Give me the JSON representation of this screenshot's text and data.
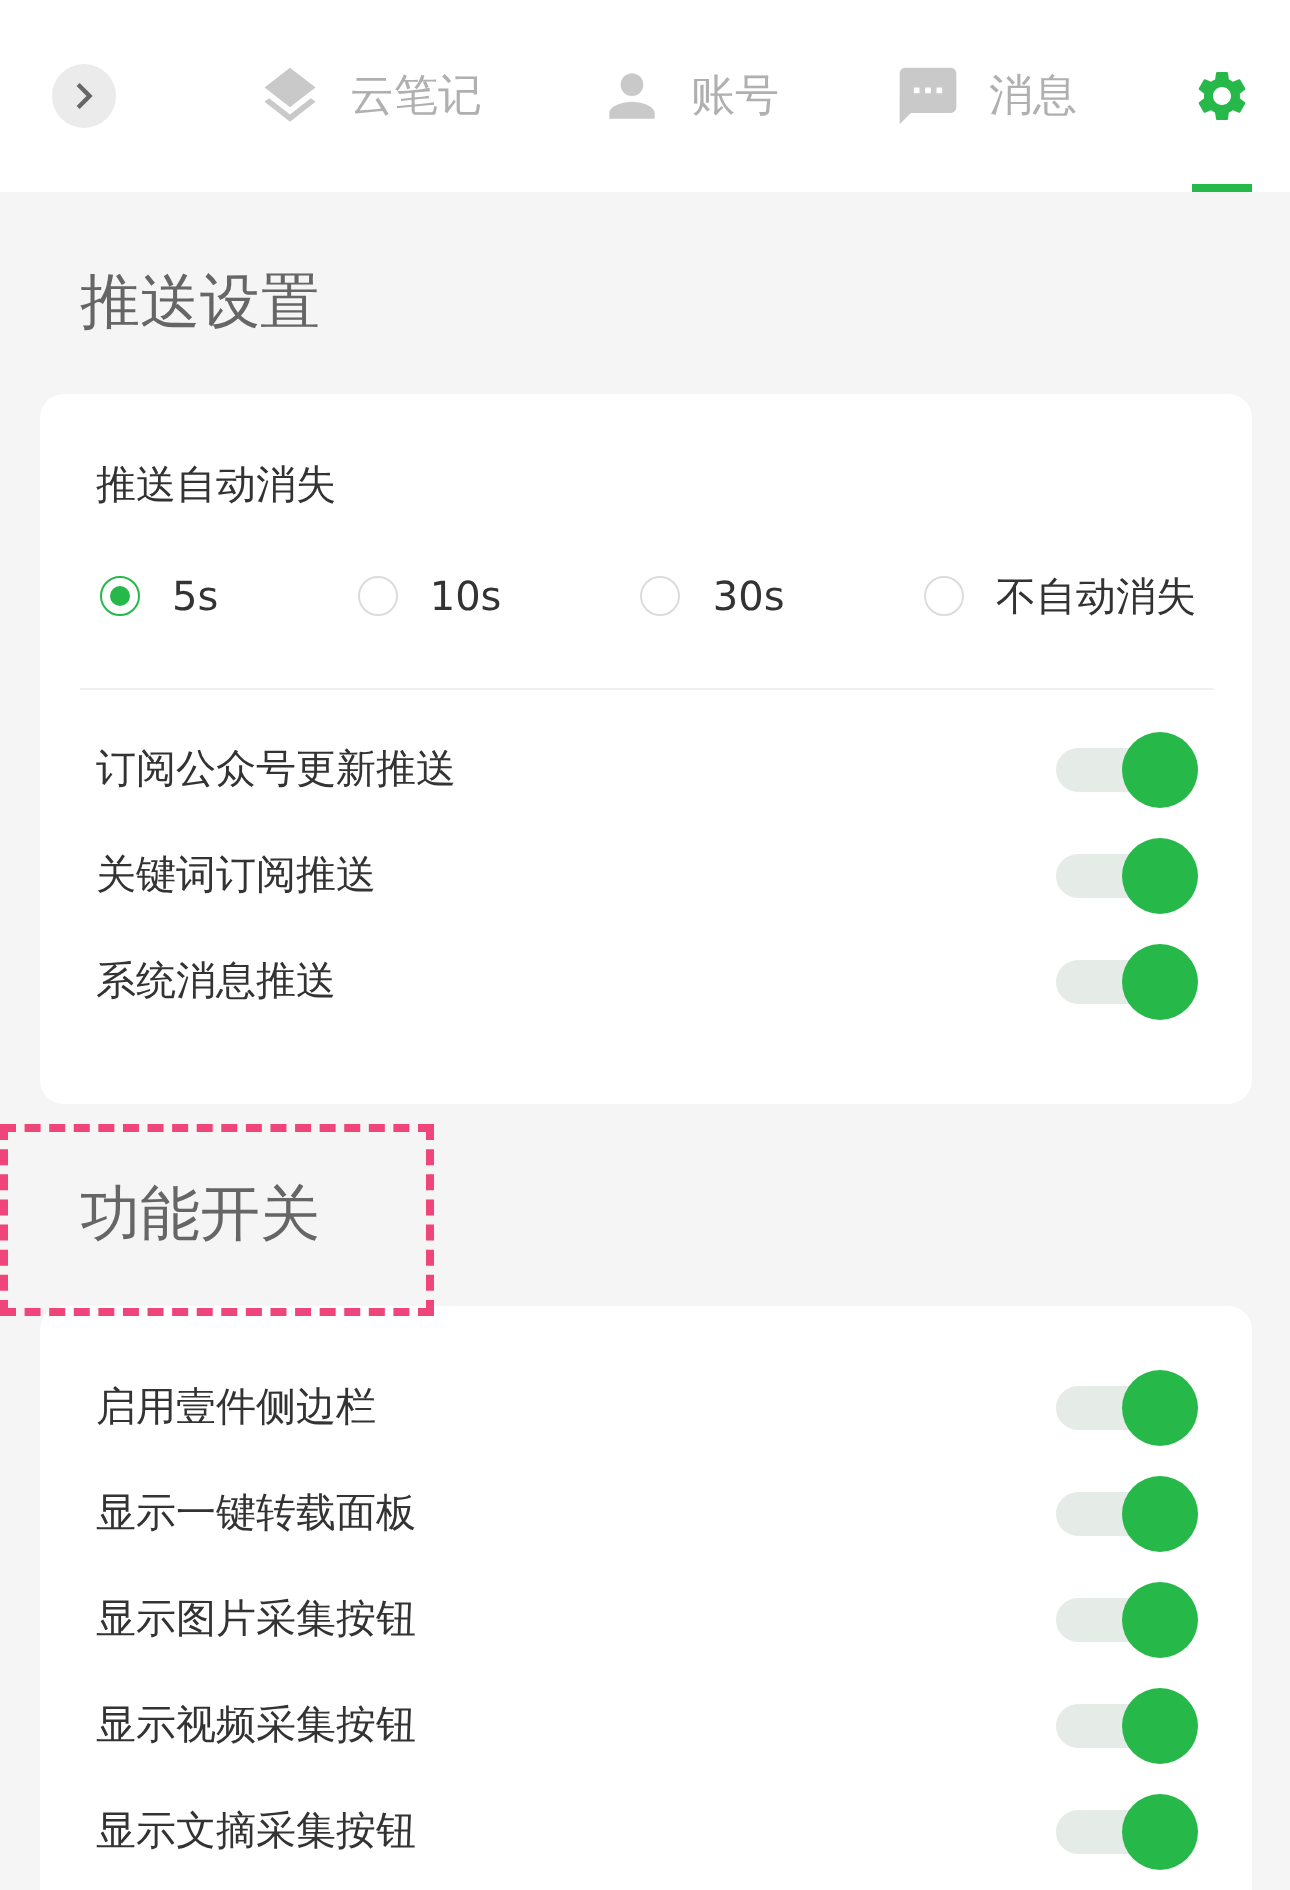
{
  "tabs": [
    {
      "kind": "stack",
      "label": "云笔记",
      "selected": false
    },
    {
      "kind": "person",
      "label": "账号",
      "selected": false
    },
    {
      "kind": "chat",
      "label": "消息",
      "selected": false
    },
    {
      "kind": "gear",
      "selected": true
    }
  ],
  "sections": [
    {
      "title": "推送设置",
      "highlighted": false,
      "radio_group": {
        "label": "推送自动消失",
        "options": [
          {
            "label": "5s",
            "selected": true
          },
          {
            "label": "10s",
            "selected": false
          },
          {
            "label": "30s",
            "selected": false
          },
          {
            "label": "不自动消失",
            "selected": false
          }
        ]
      },
      "toggles": [
        {
          "label": "订阅公众号更新推送",
          "on": true
        },
        {
          "label": "关键词订阅推送",
          "on": true
        },
        {
          "label": "系统消息推送",
          "on": true
        }
      ]
    },
    {
      "title": "功能开关",
      "highlighted": true,
      "toggles": [
        {
          "label": "启用壹件侧边栏",
          "on": true
        },
        {
          "label": "显示一键转载面板",
          "on": true
        },
        {
          "label": "显示图片采集按钮",
          "on": true
        },
        {
          "label": "显示视频采集按钮",
          "on": true
        },
        {
          "label": "显示文摘采集按钮",
          "on": true
        }
      ]
    }
  ]
}
